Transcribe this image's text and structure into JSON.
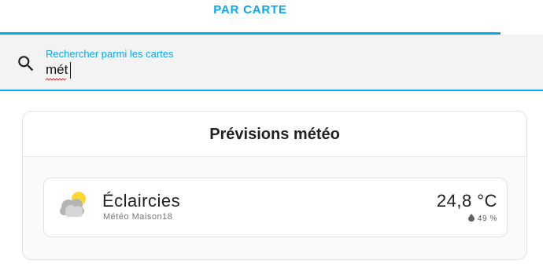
{
  "tabs": [
    {
      "label": "PAR CARTE"
    }
  ],
  "search": {
    "label": "Rechercher parmi les cartes",
    "value": "mét"
  },
  "card": {
    "title": "Prévisions météo",
    "weather": {
      "condition": "Éclaircies",
      "location": "Météo Maison18",
      "temperature": "24,8 °C",
      "humidity": "49 %",
      "icon": "partly-cloudy-icon"
    }
  },
  "colors": {
    "accent": "#03a9f4",
    "sun": "#fdd835",
    "cloud": "#b0b0b0"
  }
}
